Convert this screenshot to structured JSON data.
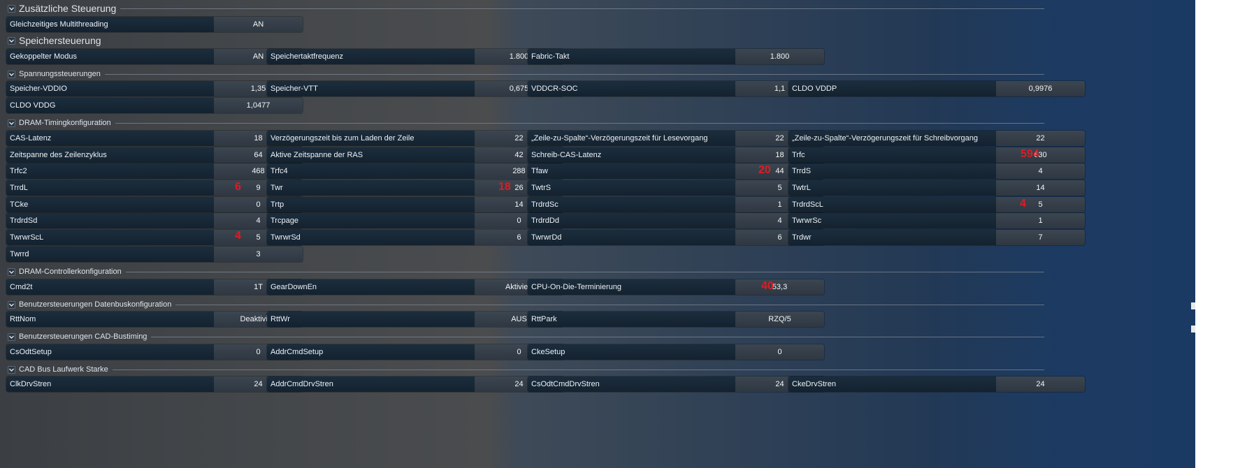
{
  "sections": [
    {
      "title": "Zusätzliche Steuerung",
      "size": "big"
    },
    {
      "title": "Speichersteuerung",
      "size": "big"
    },
    {
      "title": "Spannungssteuerungen",
      "size": "small"
    },
    {
      "title": "DRAM-Timingkonfiguration",
      "size": "small"
    },
    {
      "title": "DRAM-Controllerkonfiguration",
      "size": "small"
    },
    {
      "title": "Benutzersteuerungen Datenbuskonfiguration",
      "size": "small"
    },
    {
      "title": "Benutzersteuerungen CAD-Bustiming",
      "size": "small"
    },
    {
      "title": "CAD Bus Laufwerk Starke",
      "size": "small"
    }
  ],
  "settings": [
    {
      "name": "Gleichzeitiges Multithreading",
      "value": "AN"
    },
    {
      "name": "Gekoppelter Modus",
      "value": "AN"
    },
    {
      "name": "Speichertaktfrequenz",
      "value": "1.800"
    },
    {
      "name": "Fabric-Takt",
      "value": "1.800"
    },
    {
      "name": "Speicher-VDDIO",
      "value": "1,35"
    },
    {
      "name": "Speicher-VTT",
      "value": "0,675"
    },
    {
      "name": "VDDCR-SOC",
      "value": "1,1"
    },
    {
      "name": "CLDO VDDP",
      "value": "0,9976"
    },
    {
      "name": "CLDO VDDG",
      "value": "1,0477"
    },
    {
      "name": "CAS-Latenz",
      "value": "18"
    },
    {
      "name": "Verzögerungszeit bis zum Laden der Zeile",
      "value": "22"
    },
    {
      "name": "„Zeile-zu-Spalte“-Verzögerungszeit für Lesevorgang",
      "value": "22"
    },
    {
      "name": "„Zeile-zu-Spalte“-Verzögerungszeit für Schreibvorgang",
      "value": "22"
    },
    {
      "name": "Zeitspanne des Zeilenzyklus",
      "value": "64"
    },
    {
      "name": "Aktive Zeitspanne der RAS",
      "value": "42"
    },
    {
      "name": "Schreib-CAS-Latenz",
      "value": "18"
    },
    {
      "name": "Trfc",
      "value": "630"
    },
    {
      "name": "Trfc2",
      "value": "468"
    },
    {
      "name": "Trfc4",
      "value": "288"
    },
    {
      "name": "Tfaw",
      "value": "44"
    },
    {
      "name": "TrrdS",
      "value": "4"
    },
    {
      "name": "TrrdL",
      "value": "9"
    },
    {
      "name": "Twr",
      "value": "26"
    },
    {
      "name": "TwtrS",
      "value": "5"
    },
    {
      "name": "TwtrL",
      "value": "14"
    },
    {
      "name": "TCke",
      "value": "0"
    },
    {
      "name": "Trtp",
      "value": "14"
    },
    {
      "name": "TrdrdSc",
      "value": "1"
    },
    {
      "name": "TrdrdScL",
      "value": "5"
    },
    {
      "name": "TrdrdSd",
      "value": "4"
    },
    {
      "name": "Trcpage",
      "value": "0"
    },
    {
      "name": "TrdrdDd",
      "value": "4"
    },
    {
      "name": "TwrwrSc",
      "value": "1"
    },
    {
      "name": "TwrwrScL",
      "value": "5"
    },
    {
      "name": "TwrwrSd",
      "value": "6"
    },
    {
      "name": "TwrwrDd",
      "value": "6"
    },
    {
      "name": "Trdwr",
      "value": "7"
    },
    {
      "name": "Twrrd",
      "value": "3"
    },
    {
      "name": "Cmd2t",
      "value": "1T"
    },
    {
      "name": "GearDownEn",
      "value": "Aktiviert"
    },
    {
      "name": "CPU-On-Die-Terminierung",
      "value": "53,3"
    },
    {
      "name": "RttNom",
      "value": "Deaktiviert"
    },
    {
      "name": "RttWr",
      "value": "AUS"
    },
    {
      "name": "RttPark",
      "value": "RZQ/5"
    },
    {
      "name": "CsOdtSetup",
      "value": "0"
    },
    {
      "name": "AddrCmdSetup",
      "value": "0"
    },
    {
      "name": "CkeSetup",
      "value": "0"
    },
    {
      "name": "ClkDrvStren",
      "value": "24"
    },
    {
      "name": "AddrCmdDrvStren",
      "value": "24"
    },
    {
      "name": "CsOdtCmdDrvStren",
      "value": "24"
    },
    {
      "name": "CkeDrvStren",
      "value": "24"
    }
  ],
  "annotations": [
    {
      "text": "594",
      "setting": "Trfc"
    },
    {
      "text": "20",
      "setting": "Tfaw"
    },
    {
      "text": "6",
      "setting": "TrrdL"
    },
    {
      "text": "18",
      "setting": "Twr"
    },
    {
      "text": "4",
      "setting": "TrdrdScL"
    },
    {
      "text": "4",
      "setting": "TwrwrScL"
    },
    {
      "text": "40",
      "setting": "CPU-On-Die-Terminierung"
    }
  ],
  "colors": {
    "annotation": "#e01b24"
  },
  "icons": {
    "section_toggle": "chevron-down-icon"
  }
}
